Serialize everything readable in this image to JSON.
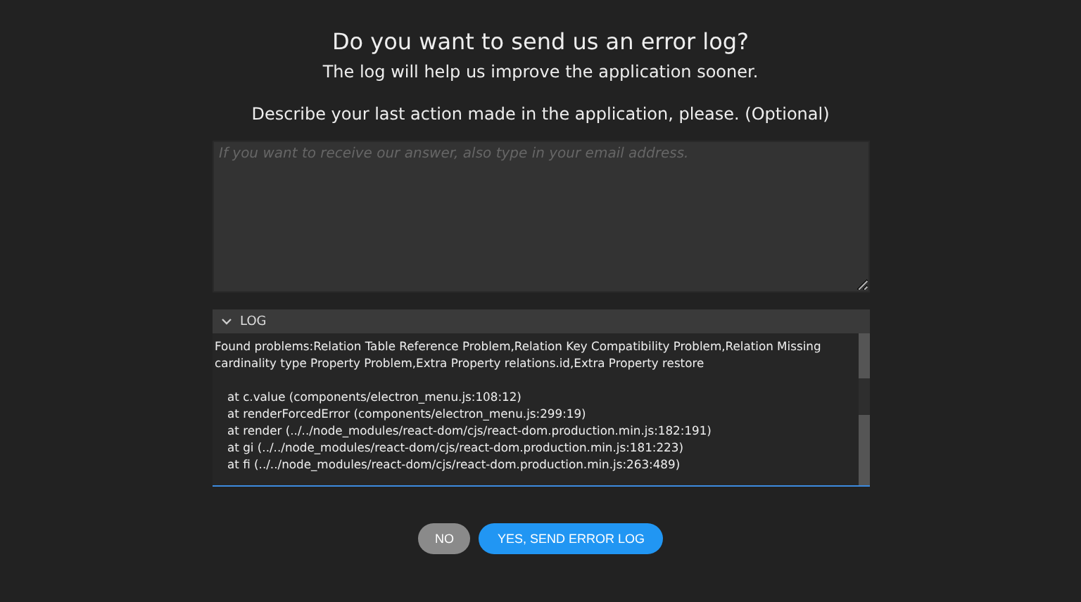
{
  "title": "Do you want to send us an error log?",
  "subtitle": "The log will help us improve the application sooner.",
  "prompt": "Describe your last action made in the application, please. (Optional)",
  "description_field": {
    "placeholder": "If you want to receive our answer, also type in your email address."
  },
  "log": {
    "label": "LOG",
    "expanded": true,
    "message": "Found problems:Relation Table Reference Problem,Relation Key Compatibility Problem,Relation Missing cardinality type Property Problem,Extra Property relations.id,Extra Property restore",
    "stack": [
      "at c.value (components/electron_menu.js:108:12)",
      "at renderForcedError (components/electron_menu.js:299:19)",
      "at render (../../node_modules/react-dom/cjs/react-dom.production.min.js:182:191)",
      "at gi (../../node_modules/react-dom/cjs/react-dom.production.min.js:181:223)",
      "at fi (../../node_modules/react-dom/cjs/react-dom.production.min.js:263:489)"
    ]
  },
  "buttons": [
    {
      "label": "NO",
      "kind": "secondary"
    },
    {
      "label": "YES, SEND ERROR LOG",
      "kind": "primary"
    }
  ]
}
